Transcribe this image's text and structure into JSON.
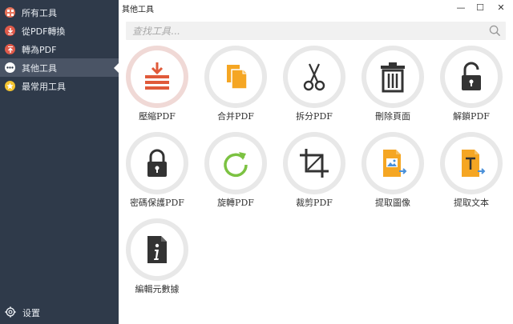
{
  "sidebar": {
    "items": [
      {
        "label": "所有工具",
        "icon": "grid-icon",
        "color": "#e8735a"
      },
      {
        "label": "從PDF轉換",
        "icon": "download-icon",
        "color": "#e05a4a"
      },
      {
        "label": "轉為PDF",
        "icon": "upload-icon",
        "color": "#e05a4a"
      },
      {
        "label": "其他工具",
        "icon": "more-icon",
        "color": "#ffffff",
        "active": true
      },
      {
        "label": "最常用工具",
        "icon": "star-icon",
        "color": "#f5c430"
      }
    ],
    "settings_label": "设置"
  },
  "window": {
    "title": "其他工具",
    "minimize": "—",
    "maximize": "☐",
    "close": "✕"
  },
  "search": {
    "placeholder": "查找工具..."
  },
  "tools": [
    {
      "label": "壓縮PDF",
      "icon": "compress-icon"
    },
    {
      "label": "合并PDF",
      "icon": "merge-icon"
    },
    {
      "label": "拆分PDF",
      "icon": "scissors-icon"
    },
    {
      "label": "刪除頁面",
      "icon": "trash-icon"
    },
    {
      "label": "解鎖PDF",
      "icon": "unlock-icon"
    },
    {
      "label": "密碼保護PDF",
      "icon": "lock-icon"
    },
    {
      "label": "旋轉PDF",
      "icon": "rotate-icon"
    },
    {
      "label": "裁剪PDF",
      "icon": "crop-icon"
    },
    {
      "label": "提取圖像",
      "icon": "extract-image-icon"
    },
    {
      "label": "提取文本",
      "icon": "extract-text-icon"
    },
    {
      "label": "編輯元數據",
      "icon": "metadata-icon"
    }
  ],
  "colors": {
    "sidebar_bg": "#2f3a4a",
    "sidebar_active": "#4a5465",
    "accent_red": "#e05a3a",
    "accent_orange": "#f5a623",
    "accent_green": "#7cc242",
    "icon_dark": "#333333"
  }
}
